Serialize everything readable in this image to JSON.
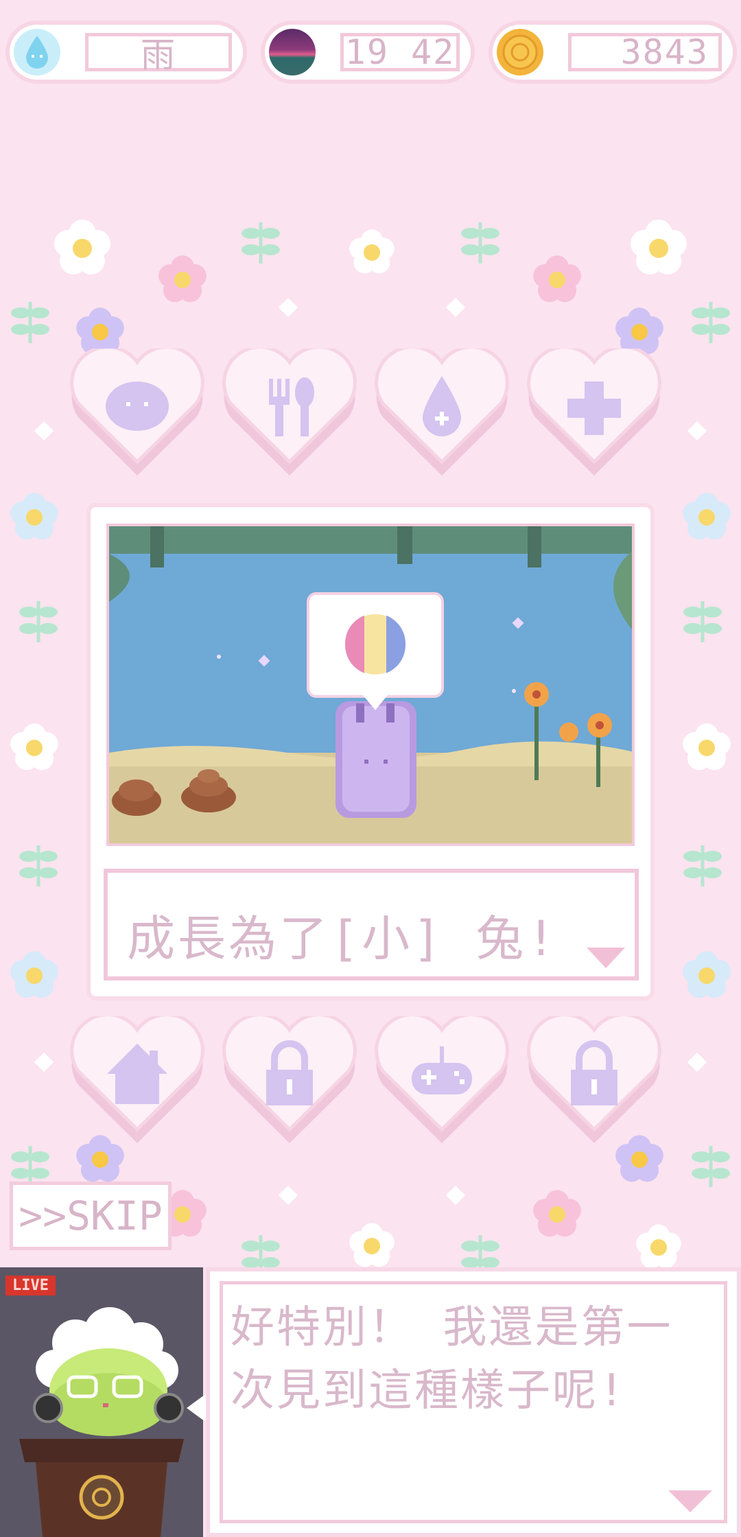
{
  "top_bar": {
    "weather": {
      "icon": "water-drop-icon",
      "value": "雨"
    },
    "time": {
      "icon": "sunset-icon",
      "value": "19 42"
    },
    "coins": {
      "icon": "coin-icon",
      "value": "3843"
    }
  },
  "action_hearts": [
    {
      "icon": "blob-face-icon"
    },
    {
      "icon": "fork-spoon-icon"
    },
    {
      "icon": "water-drop-icon"
    },
    {
      "icon": "plus-icon"
    }
  ],
  "scene": {
    "thought_bubble_icon": "striped-ball-icon",
    "caption": "成長為了[小] 兔!"
  },
  "menu_hearts": [
    {
      "icon": "house-icon"
    },
    {
      "icon": "lock-icon"
    },
    {
      "icon": "gamepad-icon"
    },
    {
      "icon": "lock-icon"
    }
  ],
  "skip_label": ">>SKIP",
  "dialog": {
    "live_badge": "LIVE",
    "line1": "好特別！ 我還是第一",
    "line2": "次見到這種樣子呢!"
  },
  "colors": {
    "background": "#fbe3ef",
    "heart": "#fdf0f6",
    "icon": "#d5c3f0",
    "text": "#d9b8cb"
  }
}
